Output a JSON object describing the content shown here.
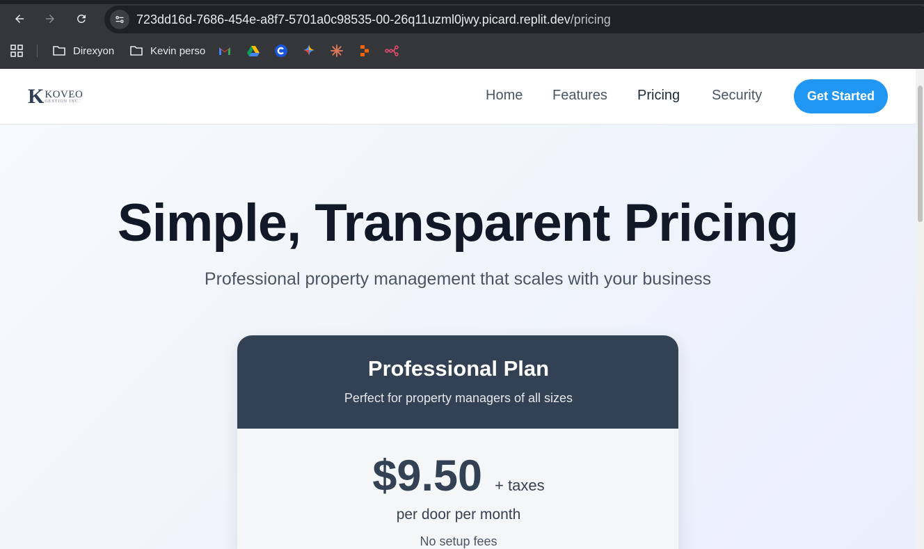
{
  "browser": {
    "url_host": "723dd16d-7686-454e-a8f7-5701a0c98535-00-26q11uzml0jwy.picard.replit.dev",
    "url_path": "/pricing",
    "bookmarks": [
      {
        "label": "Direxyon",
        "icon": "folder-icon"
      },
      {
        "label": "Kevin perso",
        "icon": "folder-icon"
      },
      {
        "label": "",
        "icon": "gmail-icon"
      },
      {
        "label": "",
        "icon": "google-drive-icon"
      },
      {
        "label": "",
        "icon": "c-app-icon"
      },
      {
        "label": "",
        "icon": "gemini-icon"
      },
      {
        "label": "",
        "icon": "claude-icon"
      },
      {
        "label": "",
        "icon": "replit-icon"
      },
      {
        "label": "",
        "icon": "n8n-icon"
      }
    ]
  },
  "header": {
    "logo_mark": "K",
    "logo_name": "KOVEO",
    "logo_sub": "GESTION INC.",
    "nav": [
      {
        "label": "Home",
        "active": false
      },
      {
        "label": "Features",
        "active": false
      },
      {
        "label": "Pricing",
        "active": true
      },
      {
        "label": "Security",
        "active": false
      }
    ],
    "cta_label": "Get Started"
  },
  "hero": {
    "title": "Simple, Transparent Pricing",
    "subtitle": "Professional property management that scales with your business"
  },
  "plan": {
    "name": "Professional Plan",
    "description": "Perfect for property managers of all sizes",
    "price": "$9.50",
    "taxes": "+ taxes",
    "unit": "per door per month",
    "note": "No setup fees"
  },
  "colors": {
    "accent": "#2196f3",
    "plan_header": "#334155",
    "title": "#111827"
  }
}
